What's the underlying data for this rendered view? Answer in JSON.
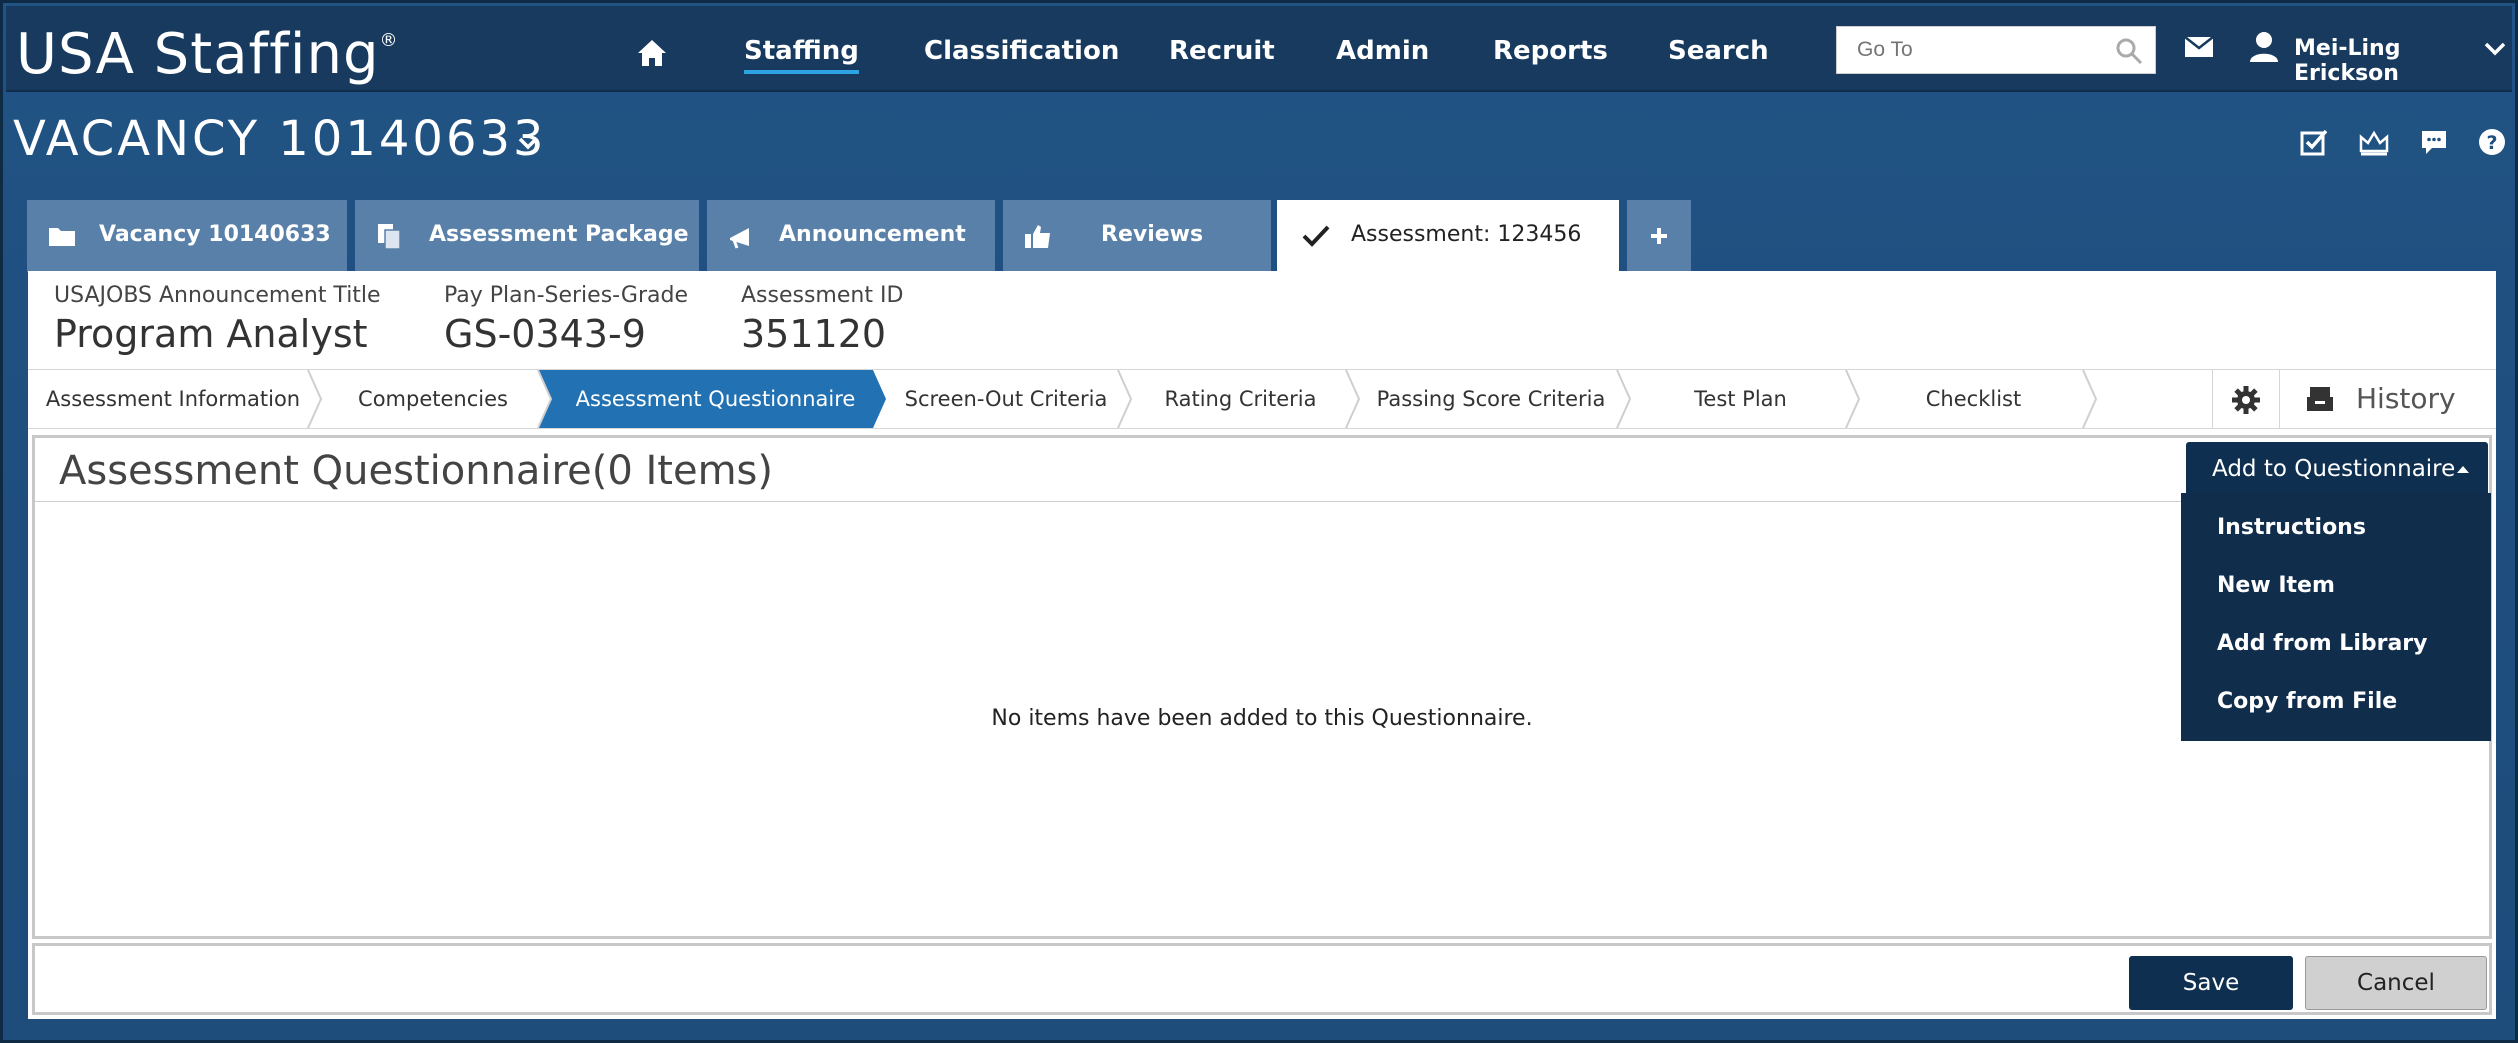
{
  "app": {
    "logo": "USA Staffing",
    "logo_mark": "®"
  },
  "nav": {
    "items": [
      "Staffing",
      "Classification",
      "Recruit",
      "Admin",
      "Reports",
      "Search"
    ],
    "active": "Staffing",
    "goto_placeholder": "Go To",
    "user_name": "Mei-Ling Erickson"
  },
  "vacancy": {
    "title": "VACANCY 10140633"
  },
  "tabs": [
    {
      "label": "Vacancy 10140633",
      "icon": "folder-icon"
    },
    {
      "label": "Assessment Package",
      "icon": "documents-icon"
    },
    {
      "label": "Announcement",
      "icon": "megaphone-icon"
    },
    {
      "label": "Reviews",
      "icon": "thumbs-up-icon"
    },
    {
      "label": "Assessment: 123456",
      "icon": "checkmark-icon",
      "active": true
    },
    {
      "label": "+",
      "icon": "plus-icon"
    }
  ],
  "info": {
    "announcement_title_label": "USAJOBS Announcement Title",
    "announcement_title_value": "Program Analyst",
    "pay_plan_label": "Pay Plan-Series-Grade",
    "pay_plan_value": "GS-0343-9",
    "assessment_id_label": "Assessment ID",
    "assessment_id_value": "351120"
  },
  "steps": [
    "Assessment Information",
    "Competencies",
    "Assessment Questionnaire",
    "Screen-Out Criteria",
    "Rating Criteria",
    "Passing Score Criteria",
    "Test Plan",
    "Checklist"
  ],
  "active_step": "Assessment Questionnaire",
  "history_label": "History",
  "content": {
    "title": "Assessment Questionnaire(0 Items)",
    "add_button": "Add to Questionnaire",
    "empty_message": "No items have been added to this Questionnaire."
  },
  "menu": {
    "items": [
      "Instructions",
      "New Item",
      "Add from Library",
      "Copy from File"
    ]
  },
  "footer": {
    "save": "Save",
    "cancel": "Cancel"
  },
  "colors": {
    "nav_bg": "#173a5e",
    "page_bg": "#1f4f7f",
    "tab_bg": "#5980a8",
    "active_step": "#2271b3",
    "primary_button": "#0f2f50",
    "nav_underline": "#2ea3e3"
  }
}
